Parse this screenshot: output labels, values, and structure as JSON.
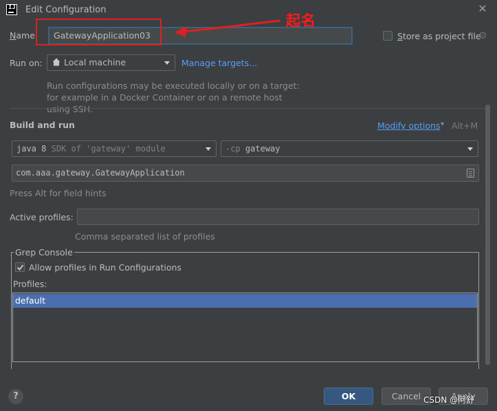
{
  "window": {
    "title": "Edit Configuration"
  },
  "name_row": {
    "label_underlined": "N",
    "label_rest": "ame:",
    "value": "GatewayApplication03",
    "store_label_underlined": "S",
    "store_label_rest": "tore as project file",
    "store_checked": false
  },
  "annotation": {
    "text": "起名",
    "color": "#ff1a1a"
  },
  "run_on": {
    "label": "Run on:",
    "selected": "Local machine",
    "manage_link": "Manage targets...",
    "hint": "Run configurations may be executed locally or on a target: for example in a Docker Container or on a remote host using SSH."
  },
  "build_and_run": {
    "title": "Build and run",
    "modify_options": "Modify options",
    "modify_shortcut": "Alt+M",
    "sdk_main": "java 8",
    "sdk_sub": "SDK of 'gateway' module",
    "cp_flag": "-cp",
    "cp_value": "gateway",
    "main_class": "com.aaa.gateway.GatewayApplication",
    "field_hint": "Press Alt for field hints"
  },
  "active_profiles": {
    "label": "Active profiles:",
    "value": "",
    "hint": "Comma separated list of profiles"
  },
  "grep_console": {
    "title": "Grep Console",
    "allow_label": "Allow profiles in Run Configurations",
    "allow_checked": true,
    "profiles_label": "Profiles:",
    "profiles": [
      "default"
    ]
  },
  "footer": {
    "help": "?",
    "ok": "OK",
    "cancel": "Cancel",
    "apply": "Apply"
  },
  "watermark": "CSDN @阿舒",
  "colors": {
    "background": "#3c3f41",
    "link": "#589df6",
    "selection": "#4b6eaf",
    "primary_button": "#365880"
  }
}
